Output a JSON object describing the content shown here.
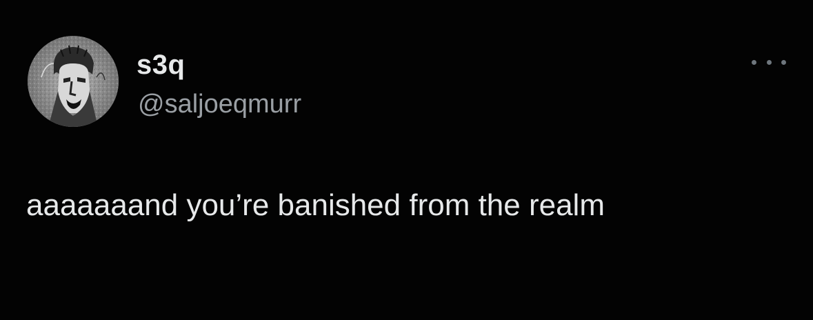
{
  "tweet": {
    "author": {
      "display_name": "s3q",
      "handle": "@saljoeqmurr",
      "avatar_icon": "avatar-sketch-portrait"
    },
    "more_icon": "more-horizontal-icon",
    "text": "aaaaaaand you’re banished from the realm"
  },
  "colors": {
    "background": "#030303",
    "primary_text": "#e7e9ea",
    "secondary_text": "#9a9fa4",
    "icon": "#6e767d"
  }
}
